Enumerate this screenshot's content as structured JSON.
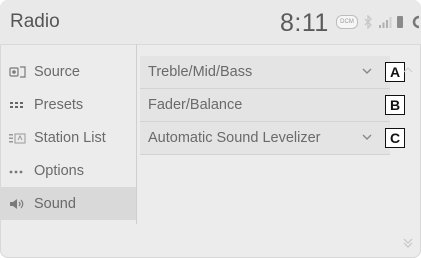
{
  "header": {
    "title": "Radio",
    "clock": "8:11",
    "dcm_badge": "DCM"
  },
  "sidebar": {
    "items": [
      {
        "label": "Source",
        "icon": "source-icon"
      },
      {
        "label": "Presets",
        "icon": "presets-icon"
      },
      {
        "label": "Station List",
        "icon": "station-list-icon"
      },
      {
        "label": "Options",
        "icon": "options-icon"
      },
      {
        "label": "Sound",
        "icon": "speaker-icon",
        "active": true
      }
    ]
  },
  "main": {
    "rows": [
      {
        "label": "Treble/Mid/Bass",
        "callout": "A",
        "has_chevron": true
      },
      {
        "label": "Fader/Balance",
        "callout": "B",
        "has_chevron": false
      },
      {
        "label": "Automatic Sound Levelizer",
        "callout": "C",
        "has_chevron": true
      }
    ]
  },
  "colors": {
    "background": "#ececec",
    "text": "#6a6a6a",
    "active_item": "#d9d9d9",
    "callout_border": "#111111"
  }
}
